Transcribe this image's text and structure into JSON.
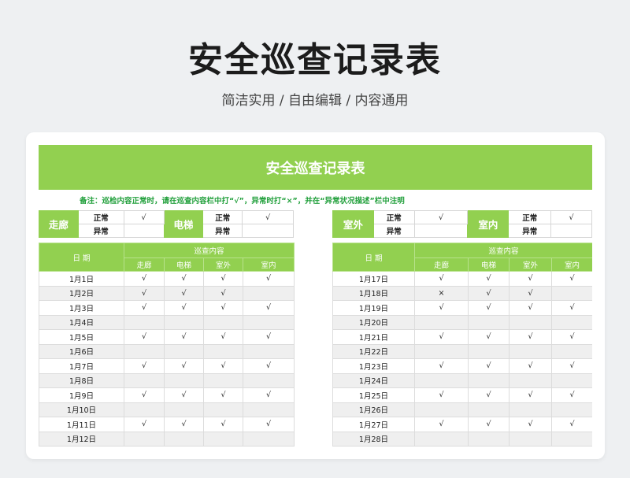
{
  "header": {
    "title": "安全巡查记录表",
    "subtitle": "简洁实用 / 自由编辑 / 内容通用"
  },
  "sheet": {
    "title": "安全巡查记录表",
    "note": "备注：巡检内容正常时，请在巡查内容栏中打“√”，异常时打“×”，并在“异常状况描述”栏中注明"
  },
  "legend": {
    "status_normal": "正常",
    "status_abnormal": "异常",
    "groups": [
      {
        "name": "走廊",
        "normal_mark": "√"
      },
      {
        "name": "电梯",
        "normal_mark": "√"
      },
      {
        "name": "室外",
        "normal_mark": "√"
      },
      {
        "name": "室内",
        "normal_mark": "√"
      }
    ]
  },
  "table": {
    "date_header": "日 期",
    "content_header": "巡查内容",
    "columns": [
      "走廊",
      "电梯",
      "室外",
      "室内"
    ],
    "left_rows": [
      {
        "date": "1月1日",
        "marks": [
          "√",
          "√",
          "√",
          "√"
        ]
      },
      {
        "date": "1月2日",
        "marks": [
          "√",
          "√",
          "√",
          ""
        ]
      },
      {
        "date": "1月3日",
        "marks": [
          "√",
          "√",
          "√",
          "√"
        ]
      },
      {
        "date": "1月4日",
        "marks": [
          "",
          "",
          "",
          ""
        ]
      },
      {
        "date": "1月5日",
        "marks": [
          "√",
          "√",
          "√",
          "√"
        ]
      },
      {
        "date": "1月6日",
        "marks": [
          "",
          "",
          "",
          ""
        ]
      },
      {
        "date": "1月7日",
        "marks": [
          "√",
          "√",
          "√",
          "√"
        ]
      },
      {
        "date": "1月8日",
        "marks": [
          "",
          "",
          "",
          ""
        ]
      },
      {
        "date": "1月9日",
        "marks": [
          "√",
          "√",
          "√",
          "√"
        ]
      },
      {
        "date": "1月10日",
        "marks": [
          "",
          "",
          "",
          ""
        ]
      },
      {
        "date": "1月11日",
        "marks": [
          "√",
          "√",
          "√",
          "√"
        ]
      },
      {
        "date": "1月12日",
        "marks": [
          "",
          "",
          "",
          ""
        ]
      }
    ],
    "right_rows": [
      {
        "date": "1月17日",
        "marks": [
          "√",
          "√",
          "√",
          "√"
        ]
      },
      {
        "date": "1月18日",
        "marks": [
          "×",
          "√",
          "√",
          ""
        ]
      },
      {
        "date": "1月19日",
        "marks": [
          "√",
          "√",
          "√",
          "√"
        ]
      },
      {
        "date": "1月20日",
        "marks": [
          "",
          "",
          "",
          ""
        ]
      },
      {
        "date": "1月21日",
        "marks": [
          "√",
          "√",
          "√",
          "√"
        ]
      },
      {
        "date": "1月22日",
        "marks": [
          "",
          "",
          "",
          ""
        ]
      },
      {
        "date": "1月23日",
        "marks": [
          "√",
          "√",
          "√",
          "√"
        ]
      },
      {
        "date": "1月24日",
        "marks": [
          "",
          "",
          "",
          ""
        ]
      },
      {
        "date": "1月25日",
        "marks": [
          "√",
          "√",
          "√",
          "√"
        ]
      },
      {
        "date": "1月26日",
        "marks": [
          "",
          "",
          "",
          ""
        ]
      },
      {
        "date": "1月27日",
        "marks": [
          "√",
          "√",
          "√",
          "√"
        ]
      },
      {
        "date": "1月28日",
        "marks": [
          "",
          "",
          "",
          ""
        ]
      }
    ]
  },
  "colors": {
    "accent_green": "#92d050",
    "note_green": "#22a03c",
    "alt_row": "#efefef"
  }
}
